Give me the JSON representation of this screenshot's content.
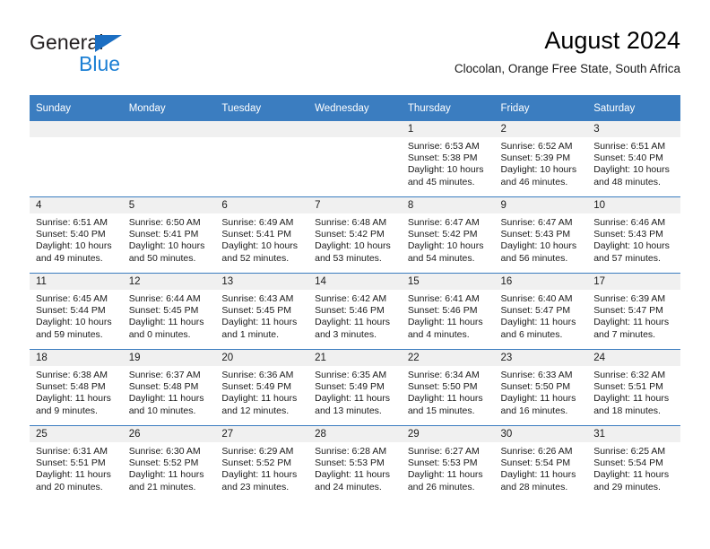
{
  "brand": {
    "name_top": "General",
    "name_bottom": "Blue",
    "triangle_icon": "blue-triangle-icon",
    "color_dark": "#231f20",
    "color_blue": "#1b7fd4"
  },
  "header": {
    "title": "August 2024",
    "subtitle": "Clocolan, Orange Free State, South Africa"
  },
  "theme": {
    "header_row_bg": "#3b7dc0",
    "daynum_bg": "#f0f0f0",
    "cell_bg": "#ffffff",
    "row_divider": "#3b7dc0"
  },
  "calendar": {
    "weekday_headers": [
      "Sunday",
      "Monday",
      "Tuesday",
      "Wednesday",
      "Thursday",
      "Friday",
      "Saturday"
    ],
    "weeks": [
      [
        {
          "day": "",
          "empty": true,
          "sunrise": "",
          "sunset": "",
          "daylight_line1": "",
          "daylight_line2": ""
        },
        {
          "day": "",
          "empty": true,
          "sunrise": "",
          "sunset": "",
          "daylight_line1": "",
          "daylight_line2": ""
        },
        {
          "day": "",
          "empty": true,
          "sunrise": "",
          "sunset": "",
          "daylight_line1": "",
          "daylight_line2": ""
        },
        {
          "day": "",
          "empty": true,
          "sunrise": "",
          "sunset": "",
          "daylight_line1": "",
          "daylight_line2": ""
        },
        {
          "day": "1",
          "empty": false,
          "sunrise": "Sunrise: 6:53 AM",
          "sunset": "Sunset: 5:38 PM",
          "daylight_line1": "Daylight: 10 hours",
          "daylight_line2": "and 45 minutes."
        },
        {
          "day": "2",
          "empty": false,
          "sunrise": "Sunrise: 6:52 AM",
          "sunset": "Sunset: 5:39 PM",
          "daylight_line1": "Daylight: 10 hours",
          "daylight_line2": "and 46 minutes."
        },
        {
          "day": "3",
          "empty": false,
          "sunrise": "Sunrise: 6:51 AM",
          "sunset": "Sunset: 5:40 PM",
          "daylight_line1": "Daylight: 10 hours",
          "daylight_line2": "and 48 minutes."
        }
      ],
      [
        {
          "day": "4",
          "empty": false,
          "sunrise": "Sunrise: 6:51 AM",
          "sunset": "Sunset: 5:40 PM",
          "daylight_line1": "Daylight: 10 hours",
          "daylight_line2": "and 49 minutes."
        },
        {
          "day": "5",
          "empty": false,
          "sunrise": "Sunrise: 6:50 AM",
          "sunset": "Sunset: 5:41 PM",
          "daylight_line1": "Daylight: 10 hours",
          "daylight_line2": "and 50 minutes."
        },
        {
          "day": "6",
          "empty": false,
          "sunrise": "Sunrise: 6:49 AM",
          "sunset": "Sunset: 5:41 PM",
          "daylight_line1": "Daylight: 10 hours",
          "daylight_line2": "and 52 minutes."
        },
        {
          "day": "7",
          "empty": false,
          "sunrise": "Sunrise: 6:48 AM",
          "sunset": "Sunset: 5:42 PM",
          "daylight_line1": "Daylight: 10 hours",
          "daylight_line2": "and 53 minutes."
        },
        {
          "day": "8",
          "empty": false,
          "sunrise": "Sunrise: 6:47 AM",
          "sunset": "Sunset: 5:42 PM",
          "daylight_line1": "Daylight: 10 hours",
          "daylight_line2": "and 54 minutes."
        },
        {
          "day": "9",
          "empty": false,
          "sunrise": "Sunrise: 6:47 AM",
          "sunset": "Sunset: 5:43 PM",
          "daylight_line1": "Daylight: 10 hours",
          "daylight_line2": "and 56 minutes."
        },
        {
          "day": "10",
          "empty": false,
          "sunrise": "Sunrise: 6:46 AM",
          "sunset": "Sunset: 5:43 PM",
          "daylight_line1": "Daylight: 10 hours",
          "daylight_line2": "and 57 minutes."
        }
      ],
      [
        {
          "day": "11",
          "empty": false,
          "sunrise": "Sunrise: 6:45 AM",
          "sunset": "Sunset: 5:44 PM",
          "daylight_line1": "Daylight: 10 hours",
          "daylight_line2": "and 59 minutes."
        },
        {
          "day": "12",
          "empty": false,
          "sunrise": "Sunrise: 6:44 AM",
          "sunset": "Sunset: 5:45 PM",
          "daylight_line1": "Daylight: 11 hours",
          "daylight_line2": "and 0 minutes."
        },
        {
          "day": "13",
          "empty": false,
          "sunrise": "Sunrise: 6:43 AM",
          "sunset": "Sunset: 5:45 PM",
          "daylight_line1": "Daylight: 11 hours",
          "daylight_line2": "and 1 minute."
        },
        {
          "day": "14",
          "empty": false,
          "sunrise": "Sunrise: 6:42 AM",
          "sunset": "Sunset: 5:46 PM",
          "daylight_line1": "Daylight: 11 hours",
          "daylight_line2": "and 3 minutes."
        },
        {
          "day": "15",
          "empty": false,
          "sunrise": "Sunrise: 6:41 AM",
          "sunset": "Sunset: 5:46 PM",
          "daylight_line1": "Daylight: 11 hours",
          "daylight_line2": "and 4 minutes."
        },
        {
          "day": "16",
          "empty": false,
          "sunrise": "Sunrise: 6:40 AM",
          "sunset": "Sunset: 5:47 PM",
          "daylight_line1": "Daylight: 11 hours",
          "daylight_line2": "and 6 minutes."
        },
        {
          "day": "17",
          "empty": false,
          "sunrise": "Sunrise: 6:39 AM",
          "sunset": "Sunset: 5:47 PM",
          "daylight_line1": "Daylight: 11 hours",
          "daylight_line2": "and 7 minutes."
        }
      ],
      [
        {
          "day": "18",
          "empty": false,
          "sunrise": "Sunrise: 6:38 AM",
          "sunset": "Sunset: 5:48 PM",
          "daylight_line1": "Daylight: 11 hours",
          "daylight_line2": "and 9 minutes."
        },
        {
          "day": "19",
          "empty": false,
          "sunrise": "Sunrise: 6:37 AM",
          "sunset": "Sunset: 5:48 PM",
          "daylight_line1": "Daylight: 11 hours",
          "daylight_line2": "and 10 minutes."
        },
        {
          "day": "20",
          "empty": false,
          "sunrise": "Sunrise: 6:36 AM",
          "sunset": "Sunset: 5:49 PM",
          "daylight_line1": "Daylight: 11 hours",
          "daylight_line2": "and 12 minutes."
        },
        {
          "day": "21",
          "empty": false,
          "sunrise": "Sunrise: 6:35 AM",
          "sunset": "Sunset: 5:49 PM",
          "daylight_line1": "Daylight: 11 hours",
          "daylight_line2": "and 13 minutes."
        },
        {
          "day": "22",
          "empty": false,
          "sunrise": "Sunrise: 6:34 AM",
          "sunset": "Sunset: 5:50 PM",
          "daylight_line1": "Daylight: 11 hours",
          "daylight_line2": "and 15 minutes."
        },
        {
          "day": "23",
          "empty": false,
          "sunrise": "Sunrise: 6:33 AM",
          "sunset": "Sunset: 5:50 PM",
          "daylight_line1": "Daylight: 11 hours",
          "daylight_line2": "and 16 minutes."
        },
        {
          "day": "24",
          "empty": false,
          "sunrise": "Sunrise: 6:32 AM",
          "sunset": "Sunset: 5:51 PM",
          "daylight_line1": "Daylight: 11 hours",
          "daylight_line2": "and 18 minutes."
        }
      ],
      [
        {
          "day": "25",
          "empty": false,
          "sunrise": "Sunrise: 6:31 AM",
          "sunset": "Sunset: 5:51 PM",
          "daylight_line1": "Daylight: 11 hours",
          "daylight_line2": "and 20 minutes."
        },
        {
          "day": "26",
          "empty": false,
          "sunrise": "Sunrise: 6:30 AM",
          "sunset": "Sunset: 5:52 PM",
          "daylight_line1": "Daylight: 11 hours",
          "daylight_line2": "and 21 minutes."
        },
        {
          "day": "27",
          "empty": false,
          "sunrise": "Sunrise: 6:29 AM",
          "sunset": "Sunset: 5:52 PM",
          "daylight_line1": "Daylight: 11 hours",
          "daylight_line2": "and 23 minutes."
        },
        {
          "day": "28",
          "empty": false,
          "sunrise": "Sunrise: 6:28 AM",
          "sunset": "Sunset: 5:53 PM",
          "daylight_line1": "Daylight: 11 hours",
          "daylight_line2": "and 24 minutes."
        },
        {
          "day": "29",
          "empty": false,
          "sunrise": "Sunrise: 6:27 AM",
          "sunset": "Sunset: 5:53 PM",
          "daylight_line1": "Daylight: 11 hours",
          "daylight_line2": "and 26 minutes."
        },
        {
          "day": "30",
          "empty": false,
          "sunrise": "Sunrise: 6:26 AM",
          "sunset": "Sunset: 5:54 PM",
          "daylight_line1": "Daylight: 11 hours",
          "daylight_line2": "and 28 minutes."
        },
        {
          "day": "31",
          "empty": false,
          "sunrise": "Sunrise: 6:25 AM",
          "sunset": "Sunset: 5:54 PM",
          "daylight_line1": "Daylight: 11 hours",
          "daylight_line2": "and 29 minutes."
        }
      ]
    ]
  }
}
